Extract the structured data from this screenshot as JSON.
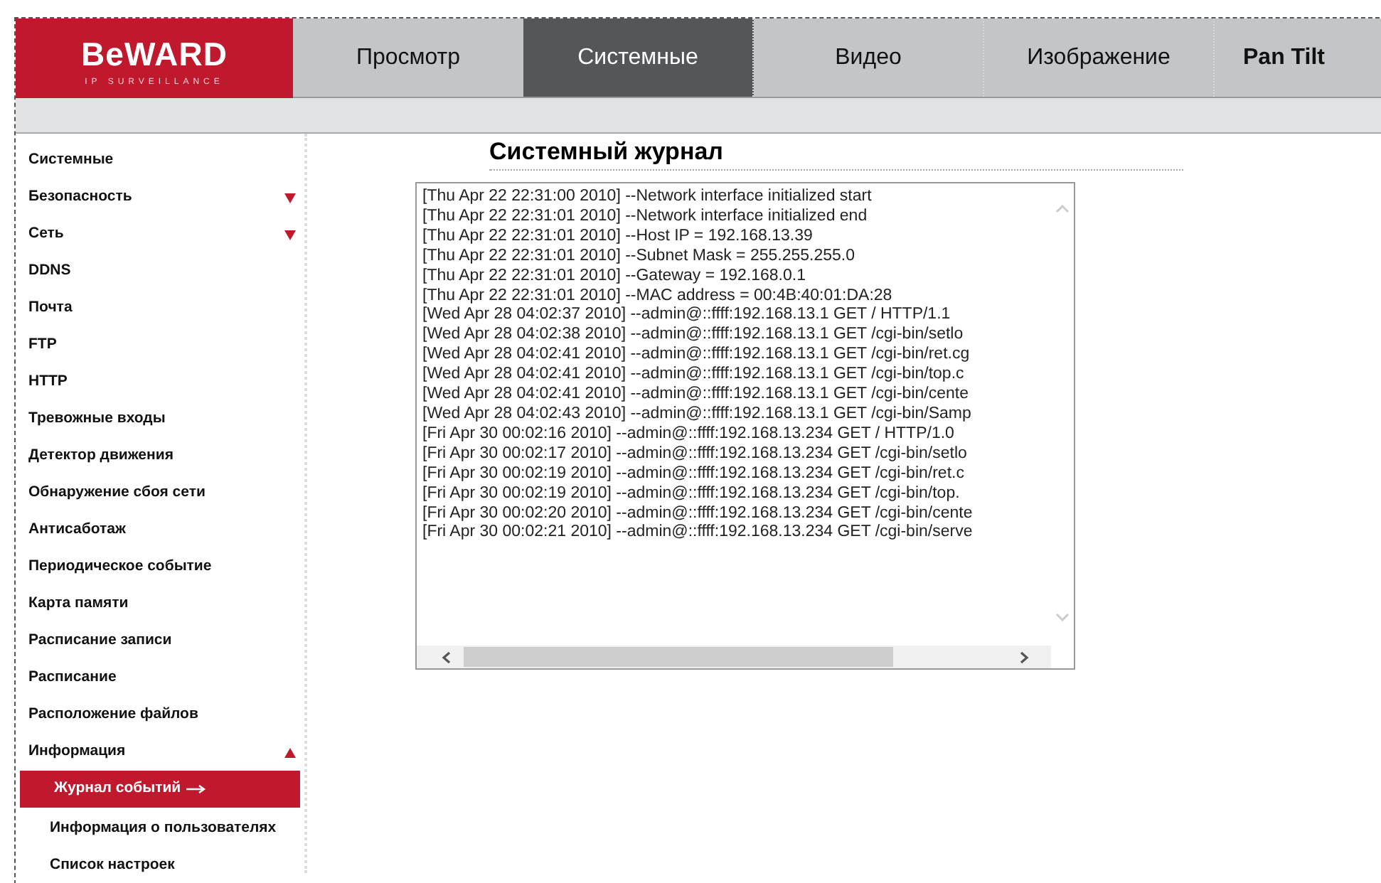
{
  "logo": {
    "brand": "BeWARD",
    "tagline": "IP SURVEILLANCE"
  },
  "tabs": [
    {
      "label": "Просмотр",
      "selected": false,
      "bold": false
    },
    {
      "label": "Системные",
      "selected": true,
      "bold": false
    },
    {
      "label": "Видео",
      "selected": false,
      "bold": false
    },
    {
      "label": "Изображение",
      "selected": false,
      "bold": false
    },
    {
      "label": "Pan Tilt",
      "selected": false,
      "bold": true
    }
  ],
  "sidebar": {
    "items": [
      {
        "label": "Системные",
        "kind": "link",
        "selected": false
      },
      {
        "label": "Безопасность",
        "kind": "folder",
        "expanded": false,
        "selected": false
      },
      {
        "label": "Сеть",
        "kind": "folder",
        "expanded": false,
        "selected": false
      },
      {
        "label": "DDNS",
        "kind": "link",
        "selected": false
      },
      {
        "label": "Почта",
        "kind": "link",
        "selected": false
      },
      {
        "label": "FTP",
        "kind": "link",
        "selected": false
      },
      {
        "label": "HTTP",
        "kind": "link",
        "selected": false
      },
      {
        "label": "Тревожные входы",
        "kind": "link",
        "selected": false
      },
      {
        "label": "Детектор движения",
        "kind": "link",
        "selected": false
      },
      {
        "label": "Обнаружение сбоя сети",
        "kind": "link",
        "selected": false
      },
      {
        "label": "Антисаботаж",
        "kind": "link",
        "selected": false
      },
      {
        "label": "Периодическое событие",
        "kind": "link",
        "selected": false
      },
      {
        "label": "Карта памяти",
        "kind": "link",
        "selected": false
      },
      {
        "label": "Расписание записи",
        "kind": "link",
        "selected": false
      },
      {
        "label": "Расписание",
        "kind": "link",
        "selected": false
      },
      {
        "label": "Расположение файлов",
        "kind": "link",
        "selected": false
      },
      {
        "label": "Информация",
        "kind": "folder",
        "expanded": true,
        "selected": false,
        "children": [
          {
            "label": "Журнал событий",
            "selected": true
          },
          {
            "label": "Информация о пользователях",
            "selected": false
          },
          {
            "label": "Список настроек",
            "selected": false
          }
        ]
      }
    ]
  },
  "content": {
    "title": "Системный журнал",
    "log_lines": [
      "[Thu Apr 22 22:31:00 2010] --Network interface initialized start",
      "[Thu Apr 22 22:31:01 2010] --Network interface initialized end",
      "[Thu Apr 22 22:31:01 2010] --Host IP = 192.168.13.39",
      "[Thu Apr 22 22:31:01 2010] --Subnet Mask = 255.255.255.0",
      "[Thu Apr 22 22:31:01 2010] --Gateway = 192.168.0.1",
      "[Thu Apr 22 22:31:01 2010] --MAC address = 00:4B:40:01:DA:28",
      "[Wed Apr 28 04:02:37 2010] --admin@::ffff:192.168.13.1 GET / HTTP/1.1",
      "[Wed Apr 28 04:02:38 2010] --admin@::ffff:192.168.13.1 GET /cgi-bin/setlo",
      "[Wed Apr 28 04:02:41 2010] --admin@::ffff:192.168.13.1 GET /cgi-bin/ret.cg",
      "[Wed Apr 28 04:02:41 2010] --admin@::ffff:192.168.13.1 GET /cgi-bin/top.c",
      "[Wed Apr 28 04:02:41 2010] --admin@::ffff:192.168.13.1 GET /cgi-bin/cente",
      "[Wed Apr 28 04:02:43 2010] --admin@::ffff:192.168.13.1 GET /cgi-bin/Samp",
      "[Fri Apr 30 00:02:16 2010] --admin@::ffff:192.168.13.234 GET / HTTP/1.0",
      "[Fri Apr 30 00:02:17 2010] --admin@::ffff:192.168.13.234 GET /cgi-bin/setlo",
      "[Fri Apr 30 00:02:19 2010] --admin@::ffff:192.168.13.234 GET /cgi-bin/ret.c",
      "[Fri Apr 30 00:02:19 2010] --admin@::ffff:192.168.13.234 GET /cgi-bin/top.",
      "[Fri Apr 30 00:02:20 2010] --admin@::ffff:192.168.13.234 GET /cgi-bin/cente",
      "[Fri Apr 30 00:02:21 2010] --admin@::ffff:192.168.13.234 GET /cgi-bin/serve"
    ]
  }
}
